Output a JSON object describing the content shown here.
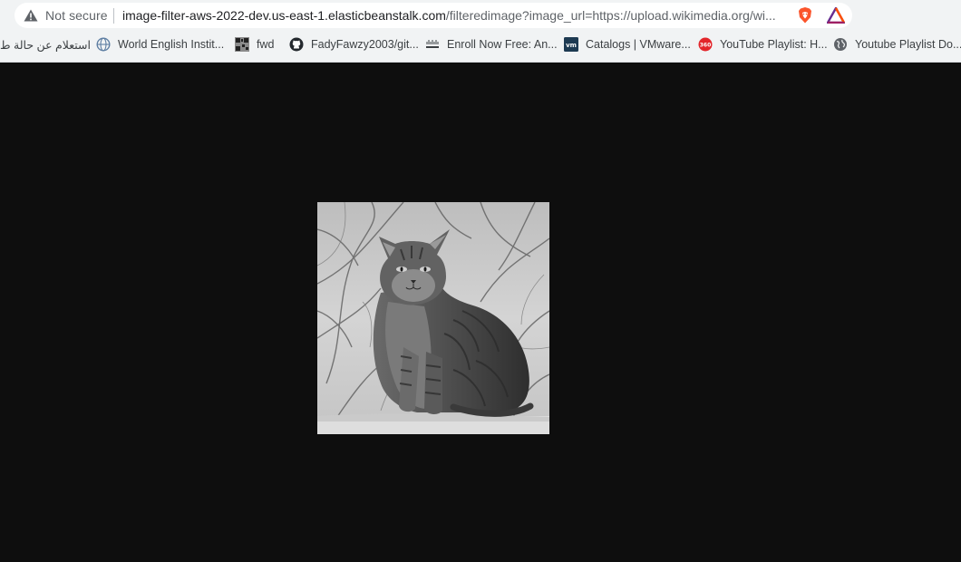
{
  "address_bar": {
    "security_label": "Not secure",
    "url_host": "image-filter-aws-2022-dev.us-east-1.elasticbeanstalk.com",
    "url_path": "/filteredimage?image_url=https://upload.wikimedia.org/wi..."
  },
  "bookmarks": [
    {
      "label": "استعلام عن حالة ط",
      "icon": "rtl-text"
    },
    {
      "label": "World English Instit...",
      "icon": "globe-icon"
    },
    {
      "label": "fwd",
      "icon": "qr-icon"
    },
    {
      "label": "FadyFawzy2003/git...",
      "icon": "github-icon"
    },
    {
      "label": "Enroll Now Free: An...",
      "icon": "cisco-icon"
    },
    {
      "label": "Catalogs | VMware...",
      "icon": "vmware-icon"
    },
    {
      "label": "YouTube Playlist: H...",
      "icon": "360-icon"
    },
    {
      "label": "Youtube Playlist Do...",
      "icon": "globe-icon"
    }
  ],
  "content": {
    "image_alt": "Grayscale photo of a tabby cat sitting on a ledge",
    "filter": "grayscale"
  },
  "colors": {
    "page_background": "#0e0e0e",
    "chrome_background": "#f1f3f4",
    "brave_orange": "#fb542b"
  }
}
